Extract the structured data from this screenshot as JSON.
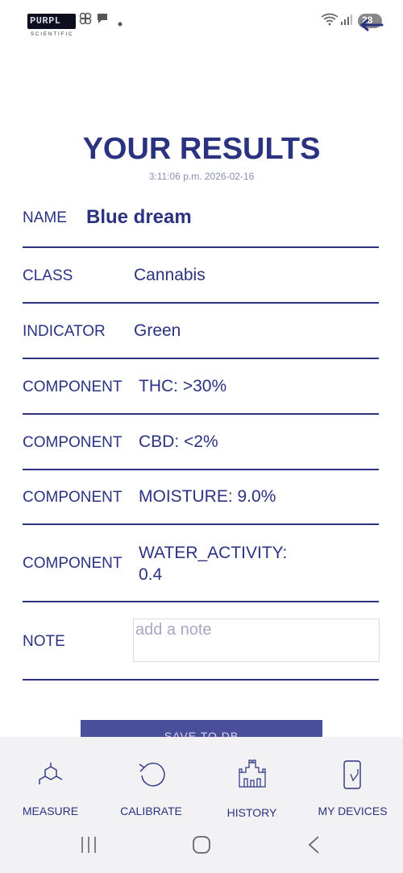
{
  "status_bar": {
    "logo_text": "PURPL",
    "logo_sub": "SCIENTIFIC",
    "battery": "28"
  },
  "page": {
    "title": "YOUR RESULTS",
    "timestamp": "3:11:06 p.m. 2026-02-16"
  },
  "results": {
    "name_label": "NAME",
    "name_value": "Blue dream",
    "class_label": "CLASS",
    "class_value": "Cannabis",
    "indicator_label": "INDICATOR",
    "indicator_value": "Green",
    "components": [
      {
        "label": "COMPONENT",
        "value": "THC: >30%"
      },
      {
        "label": "COMPONENT",
        "value": "CBD: <2%"
      },
      {
        "label": "COMPONENT",
        "value": "MOISTURE: 9.0%"
      },
      {
        "label": "COMPONENT",
        "value_line1": "WATER_ACTIVITY:",
        "value_line2": "0.4"
      }
    ],
    "note_label": "NOTE",
    "note_placeholder": "add a note"
  },
  "save_button": "SAVE TO DB",
  "bottom_nav": [
    {
      "label": "MEASURE",
      "icon": "molecule-icon"
    },
    {
      "label": "CALIBRATE",
      "icon": "refresh-icon"
    },
    {
      "label": "HISTORY",
      "icon": "castle-icon"
    },
    {
      "label": "MY DEVICES",
      "icon": "phone-icon"
    }
  ]
}
